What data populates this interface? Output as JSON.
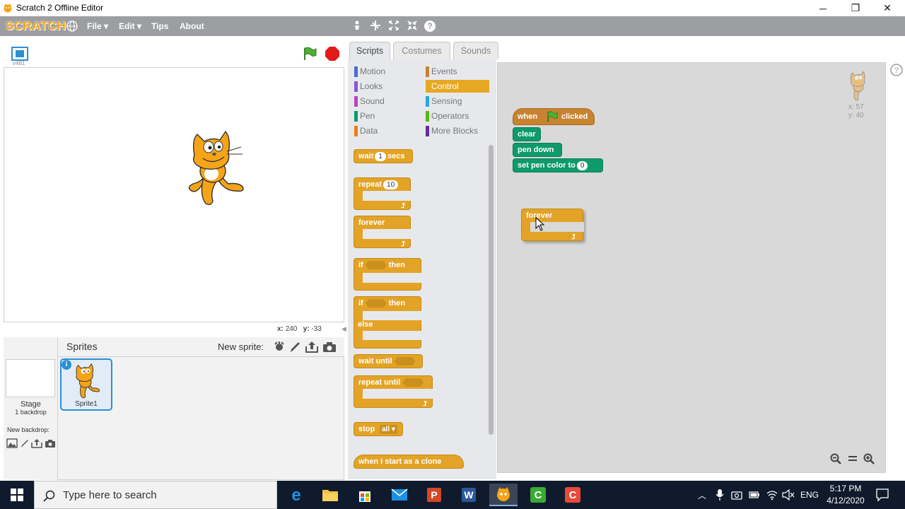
{
  "window": {
    "title": "Scratch 2 Offline Editor",
    "min": "─",
    "max": "❐",
    "close": "✕"
  },
  "menubar": {
    "logo": "SCRATCH",
    "items": [
      "File ▾",
      "Edit ▾",
      "Tips",
      "About"
    ]
  },
  "stage": {
    "version": "v461",
    "coords_x_label": "x:",
    "coords_x": "240",
    "coords_y_label": "y:",
    "coords_y": "-33"
  },
  "sprites": {
    "header": "Sprites",
    "new_sprite_label": "New sprite:",
    "stage_label": "Stage",
    "stage_backdrops": "1 backdrop",
    "new_backdrop_label": "New backdrop:",
    "sprite1_name": "Sprite1",
    "info_badge": "i"
  },
  "tabs": [
    "Scripts",
    "Costumes",
    "Sounds"
  ],
  "categories_left": [
    {
      "label": "Motion",
      "color": "#4a6cd4"
    },
    {
      "label": "Looks",
      "color": "#8a55d7"
    },
    {
      "label": "Sound",
      "color": "#bb42c3"
    },
    {
      "label": "Pen",
      "color": "#0e9a6c"
    },
    {
      "label": "Data",
      "color": "#ee7d16"
    }
  ],
  "categories_right": [
    {
      "label": "Events",
      "color": "#c88330"
    },
    {
      "label": "Control",
      "color": "#e6a822",
      "selected": true
    },
    {
      "label": "Sensing",
      "color": "#2ca5e2"
    },
    {
      "label": "Operators",
      "color": "#5cb712"
    },
    {
      "label": "More Blocks",
      "color": "#632d99"
    }
  ],
  "palette": {
    "wait": "wait",
    "wait_val": "1",
    "wait_secs": "secs",
    "repeat": "repeat",
    "repeat_val": "10",
    "forever": "forever",
    "if": "if",
    "then": "then",
    "if2": "if",
    "then2": "then",
    "else": "else",
    "wait_until": "wait until",
    "repeat_until": "repeat until",
    "stop": "stop",
    "stop_val": "all ▾",
    "clone": "when I start as a clone"
  },
  "script": {
    "when": "when",
    "clicked": "clicked",
    "clear": "clear",
    "pen_down": "pen down",
    "set_pen_color": "set pen color to",
    "pen_color_val": "0",
    "forever": "forever"
  },
  "sprite_info": {
    "x": "x: 57",
    "y": "y: 40"
  },
  "taskbar": {
    "search_placeholder": "Type here to search",
    "lang": "ENG",
    "time": "5:17 PM",
    "date": "4/12/2020"
  }
}
